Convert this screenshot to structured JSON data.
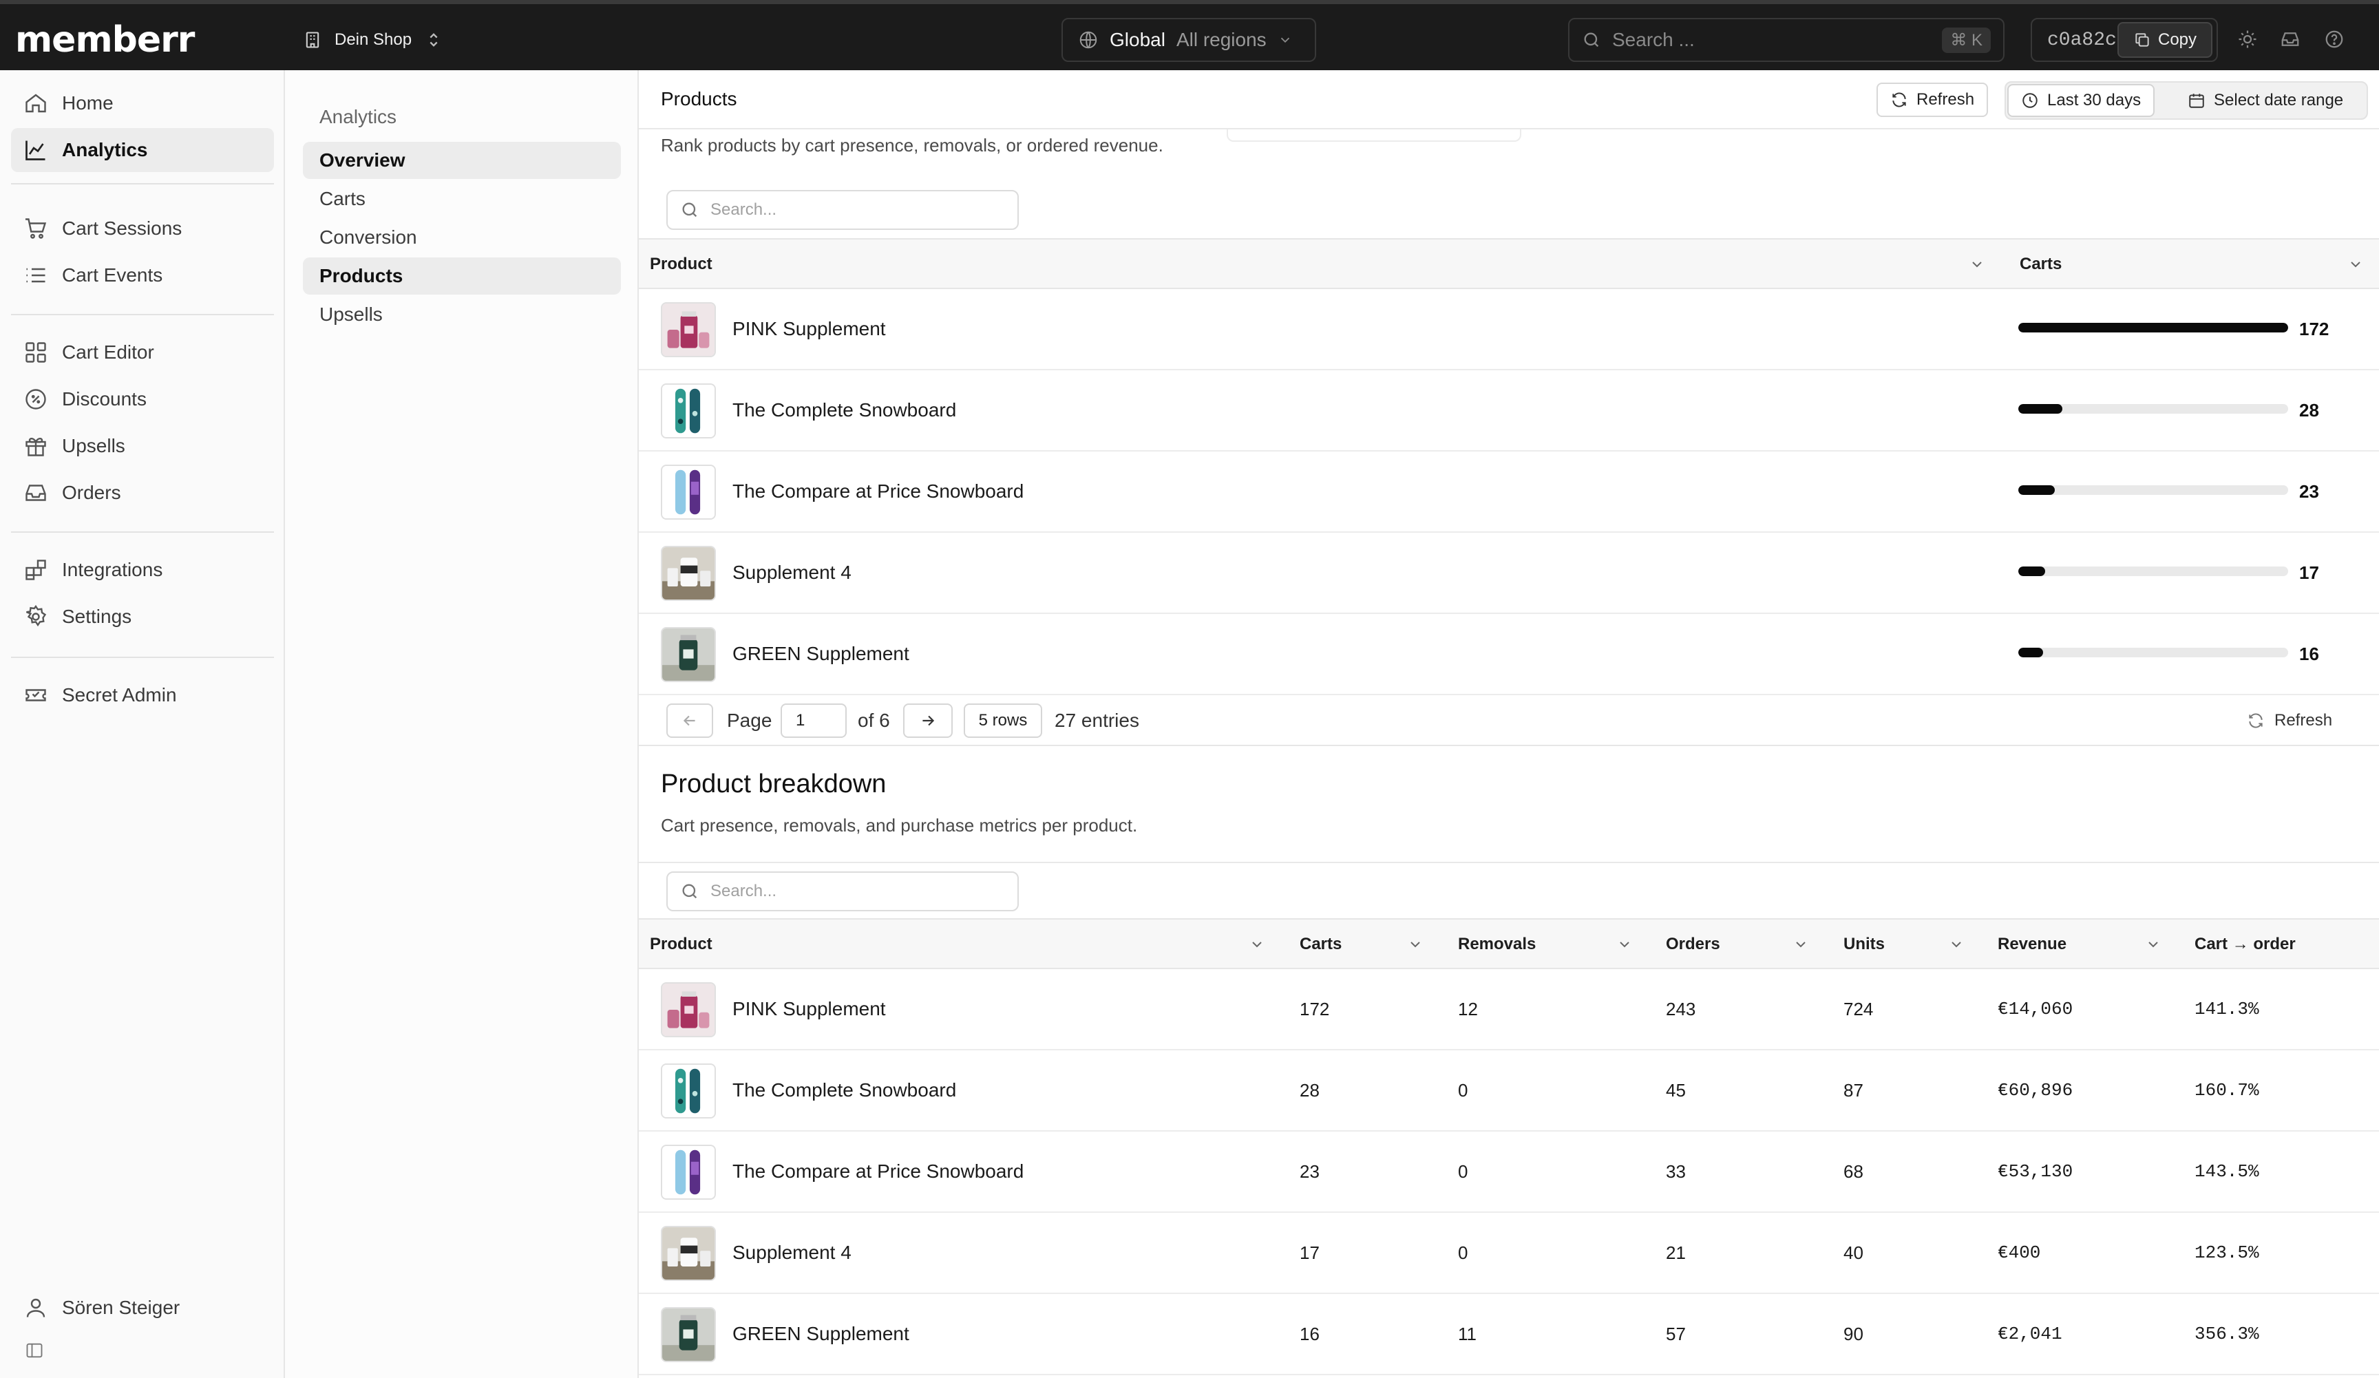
{
  "app": {
    "logo": "memberr",
    "shop": "Dein Shop",
    "region_label": "Global",
    "region_value": "All regions",
    "search_placeholder": "Search ...",
    "shortcut": "⌘ K",
    "id_value": "c0a82c",
    "copy_label": "Copy"
  },
  "sidebar": {
    "items": [
      {
        "label": "Home",
        "icon": "home-icon"
      },
      {
        "label": "Analytics",
        "icon": "chart-line-icon",
        "active": true
      },
      {
        "label": "Cart Sessions",
        "icon": "cart-icon"
      },
      {
        "label": "Cart Events",
        "icon": "list-icon"
      },
      {
        "label": "Cart Editor",
        "icon": "grid-icon"
      },
      {
        "label": "Discounts",
        "icon": "discount-icon"
      },
      {
        "label": "Upsells",
        "icon": "gift-icon"
      },
      {
        "label": "Orders",
        "icon": "inbox-icon"
      },
      {
        "label": "Integrations",
        "icon": "puzzle-icon"
      },
      {
        "label": "Settings",
        "icon": "gear-icon"
      },
      {
        "label": "Secret Admin",
        "icon": "ticket-icon"
      }
    ],
    "user": "Sören Steiger"
  },
  "subnav": {
    "heading": "Analytics",
    "items": [
      "Overview",
      "Carts",
      "Conversion",
      "Products",
      "Upsells"
    ],
    "active_index": 3
  },
  "main": {
    "title": "Products",
    "refresh_label": "Refresh",
    "last30_label": "Last 30 days",
    "daterange_label": "Select date range",
    "rank_text": "Rank products by cart presence, removals, or ordered revenue.",
    "search_placeholder": "Search...",
    "top_columns": {
      "product": "Product",
      "carts": "Carts"
    },
    "top_rows": [
      {
        "name": "PINK Supplement",
        "carts": "172",
        "carts_share": 1.0
      },
      {
        "name": "The Complete Snowboard",
        "carts": "28",
        "carts_share": 0.163
      },
      {
        "name": "The Compare at Price Snowboard",
        "carts": "23",
        "carts_share": 0.134
      },
      {
        "name": "Supplement 4",
        "carts": "17",
        "carts_share": 0.099
      },
      {
        "name": "GREEN Supplement",
        "carts": "16",
        "carts_share": 0.093
      }
    ],
    "pager": {
      "page_label": "Page",
      "page_value": "1",
      "of_label": "of 6",
      "rows_label": "5 rows",
      "entries_label": "27 entries",
      "refresh_label": "Refresh"
    },
    "breakdown": {
      "title": "Product breakdown",
      "subtitle": "Cart presence, removals, and purchase metrics per product.",
      "columns": [
        "Product",
        "Carts",
        "Removals",
        "Orders",
        "Units",
        "Revenue",
        "Cart → order"
      ],
      "rows": [
        {
          "name": "PINK Supplement",
          "carts": "172",
          "removals": "12",
          "orders": "243",
          "units": "724",
          "revenue": "€14,060",
          "rate": "141.3%"
        },
        {
          "name": "The Complete Snowboard",
          "carts": "28",
          "removals": "0",
          "orders": "45",
          "units": "87",
          "revenue": "€60,896",
          "rate": "160.7%"
        },
        {
          "name": "The Compare at Price Snowboard",
          "carts": "23",
          "removals": "0",
          "orders": "33",
          "units": "68",
          "revenue": "€53,130",
          "rate": "143.5%"
        },
        {
          "name": "Supplement 4",
          "carts": "17",
          "removals": "0",
          "orders": "21",
          "units": "40",
          "revenue": "€400",
          "rate": "123.5%"
        },
        {
          "name": "GREEN Supplement",
          "carts": "16",
          "removals": "11",
          "orders": "57",
          "units": "90",
          "revenue": "€2,041",
          "rate": "356.3%"
        }
      ]
    }
  },
  "colors": {
    "topbar": "#1b1b1b",
    "accent": "#0a0a0a",
    "sidebar": "#fafafa"
  }
}
